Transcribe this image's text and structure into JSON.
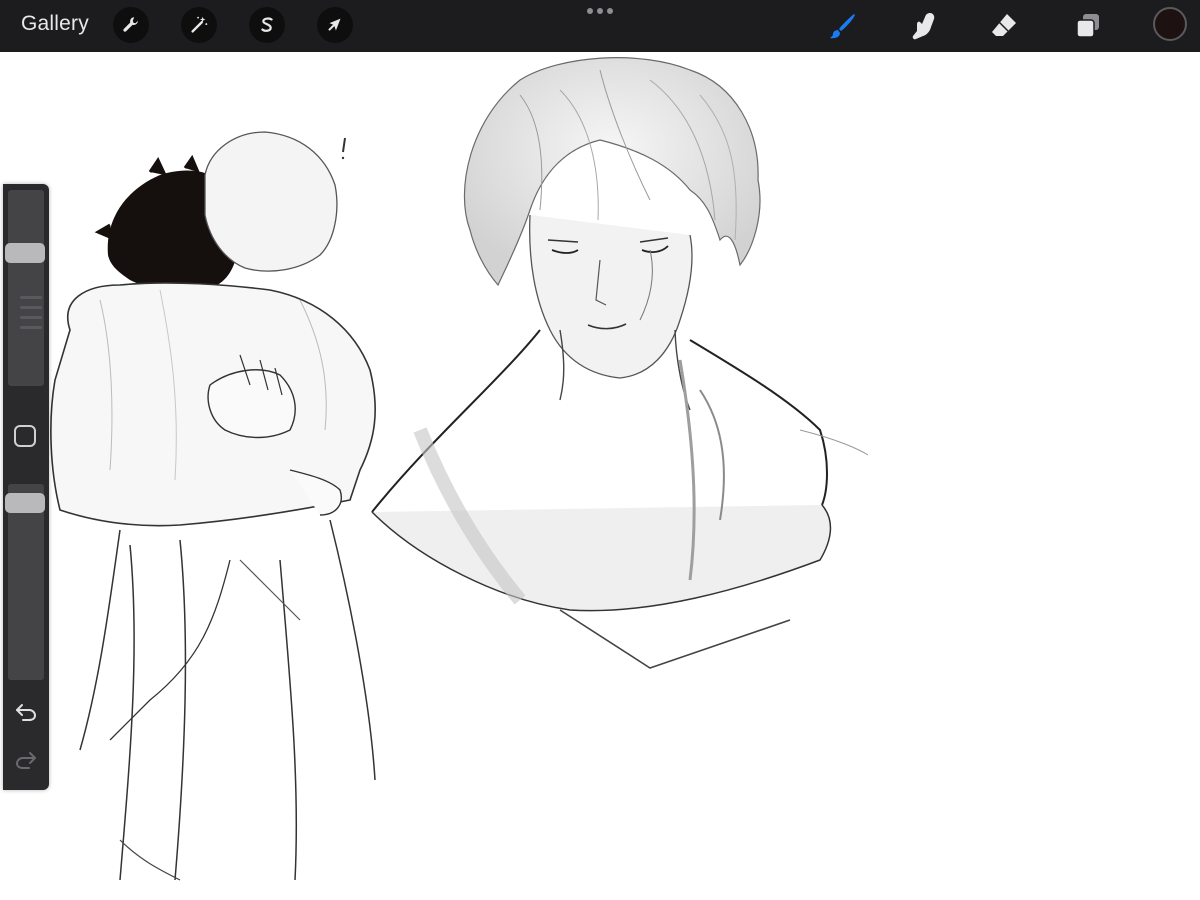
{
  "toolbar": {
    "gallery_label": "Gallery",
    "left_tools": [
      {
        "name": "actions",
        "icon": "wrench-icon"
      },
      {
        "name": "adjustments",
        "icon": "magic-wand-icon"
      },
      {
        "name": "selection",
        "icon": "selection-s-icon"
      },
      {
        "name": "transform",
        "icon": "arrow-cursor-icon"
      }
    ],
    "more_icon": "more-dots-icon",
    "right_tools": [
      {
        "name": "brush",
        "icon": "brush-icon",
        "active": true,
        "color": "#1a7cf5"
      },
      {
        "name": "smudge",
        "icon": "smudge-finger-icon",
        "active": false
      },
      {
        "name": "eraser",
        "icon": "eraser-icon",
        "active": false
      },
      {
        "name": "layers",
        "icon": "layers-icon",
        "active": false
      }
    ],
    "current_color": "#1d1211"
  },
  "sidebar": {
    "brush_size_level": 0.7,
    "opacity_level": 0.95,
    "modify_icon": "square-modify-icon",
    "undo_icon": "undo-icon",
    "redo_icon": "redo-icon"
  },
  "colors": {
    "toolbar_bg": "#1c1c1e",
    "active_accent": "#1a7cf5",
    "sidebar_bg": "#2a2a2c",
    "canvas_bg": "#ffffff"
  }
}
